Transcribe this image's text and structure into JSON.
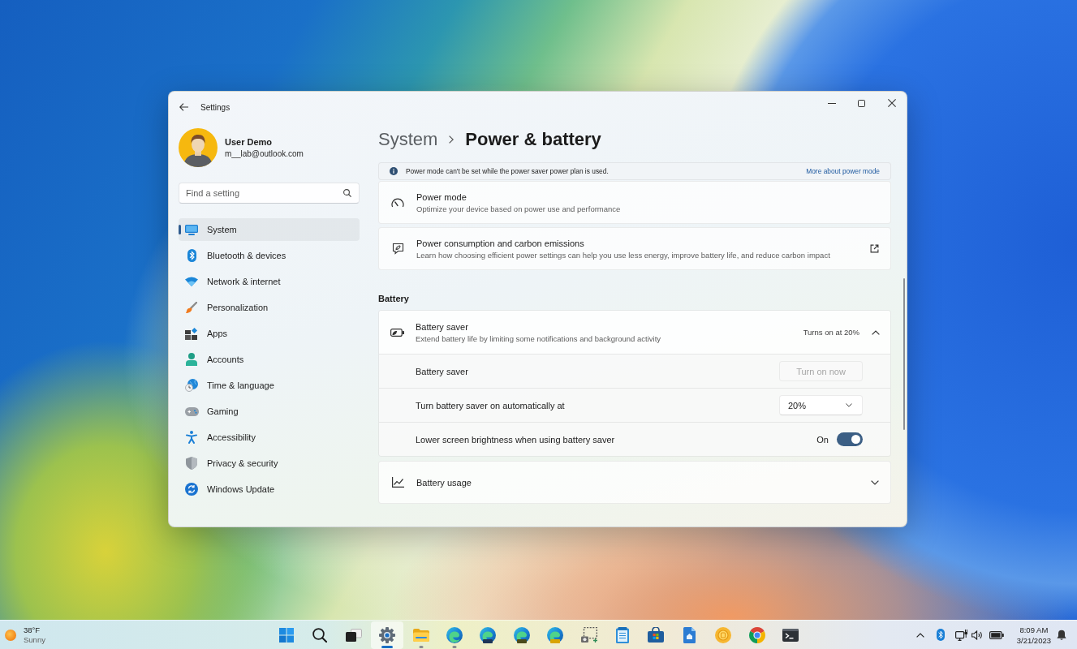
{
  "window": {
    "title": "Settings"
  },
  "account": {
    "name": "User Demo",
    "email": "m__lab@outlook.com"
  },
  "search": {
    "placeholder": "Find a setting"
  },
  "sidebar": {
    "items": [
      {
        "label": "System",
        "selected": true
      },
      {
        "label": "Bluetooth & devices",
        "selected": false
      },
      {
        "label": "Network & internet",
        "selected": false
      },
      {
        "label": "Personalization",
        "selected": false
      },
      {
        "label": "Apps",
        "selected": false
      },
      {
        "label": "Accounts",
        "selected": false
      },
      {
        "label": "Time & language",
        "selected": false
      },
      {
        "label": "Gaming",
        "selected": false
      },
      {
        "label": "Accessibility",
        "selected": false
      },
      {
        "label": "Privacy & security",
        "selected": false
      },
      {
        "label": "Windows Update",
        "selected": false
      }
    ]
  },
  "page_header": {
    "breadcrumb": "System",
    "title": "Power & battery"
  },
  "notice": {
    "text": "Power mode can't be set while the power saver power plan is used.",
    "link": "More about power mode"
  },
  "cards": [
    {
      "kind": "plain",
      "title": "Power mode",
      "description": "Optimize your device based on power use and performance"
    },
    {
      "kind": "external",
      "title": "Power consumption and carbon emissions",
      "description": "Learn how choosing efficient power settings can help you use less energy, improve battery life, and reduce carbon impact"
    }
  ],
  "battery": {
    "heading": "Battery",
    "saver": {
      "title": "Battery saver",
      "description": "Extend battery life by limiting some notifications and background activity",
      "status": "Turns on at 20%",
      "expanded": true,
      "rows": [
        {
          "kind": "button",
          "label": "Battery saver",
          "button": "Turn on now",
          "disabled": true
        },
        {
          "kind": "dropdown",
          "label": "Turn battery saver on automatically at",
          "value": "20%"
        },
        {
          "kind": "toggle",
          "label": "Lower screen brightness when using battery saver",
          "state": "On",
          "on": true
        }
      ]
    },
    "usage": {
      "title": "Battery usage",
      "expanded": false
    }
  },
  "taskbar": {
    "weather": {
      "temperature": "38°F",
      "condition": "Sunny"
    },
    "buttons": [
      {
        "selected": false,
        "running": false
      },
      {
        "selected": false,
        "running": false
      },
      {
        "selected": false,
        "running": false
      },
      {
        "selected": true,
        "running": true
      },
      {
        "selected": false,
        "running": true
      },
      {
        "selected": false,
        "running": true
      },
      {
        "selected": false,
        "running": false
      },
      {
        "selected": false,
        "running": false
      },
      {
        "selected": false,
        "running": false
      },
      {
        "selected": false,
        "running": false
      },
      {
        "selected": false,
        "running": false
      },
      {
        "selected": false,
        "running": false
      },
      {
        "selected": false,
        "running": false
      },
      {
        "selected": false,
        "running": false
      },
      {
        "selected": false,
        "running": false
      },
      {
        "selected": false,
        "running": false
      }
    ],
    "clock": {
      "time": "8:09 AM",
      "date": "3/21/2023"
    }
  }
}
